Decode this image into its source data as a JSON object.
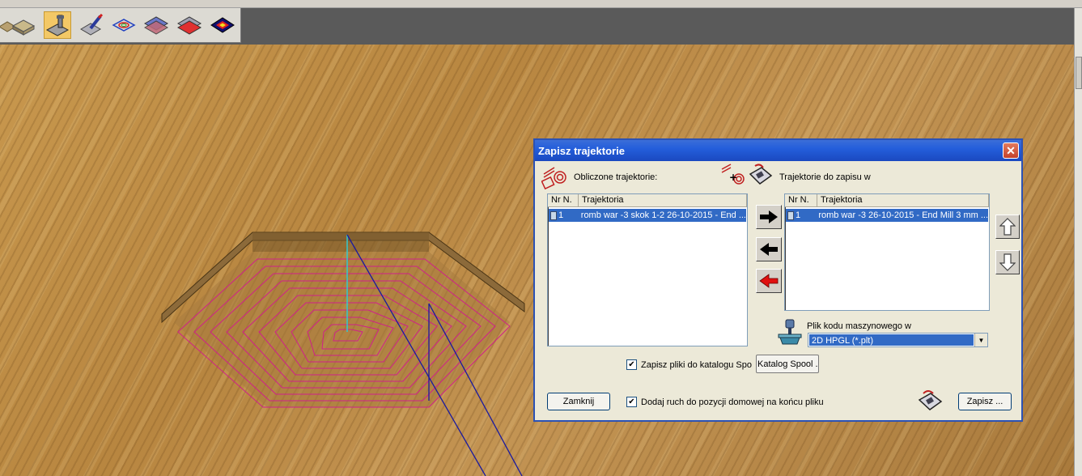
{
  "toolbar": {
    "buttons": [
      {
        "icon": "material-block-icon"
      },
      {
        "icon": "mill-tool-icon",
        "active": true
      },
      {
        "icon": "brush-icon"
      },
      {
        "icon": "layers-outline-icon"
      },
      {
        "icon": "layer-blue-icon"
      },
      {
        "icon": "layer-red-icon"
      },
      {
        "icon": "heatmap-diamond-icon"
      }
    ]
  },
  "dialog": {
    "title": "Zapisz trajektorie",
    "computed_label": "Obliczone trajektorie:",
    "to_save_label": "Trajektorie do zapisu w",
    "left_list": {
      "columns": [
        "Nr N.",
        "Trajektoria"
      ],
      "rows": [
        {
          "nr": "1",
          "name": "romb war -3 skok 1-2  26-10-2015 - End ..."
        }
      ]
    },
    "right_list": {
      "columns": [
        "Nr N.",
        "Trajektoria"
      ],
      "rows": [
        {
          "nr": "1",
          "name": "romb war -3   26-10-2015 - End Mill 3 mm ..."
        }
      ]
    },
    "machine_code_label": "Plik kodu maszynowego w",
    "machine_code_value": "2D HPGL (*.plt)",
    "spool_checkbox_label": "Zapisz pliki do katalogu Spo",
    "spool_button": "Katalog Spool ..",
    "home_checkbox_label": "Dodaj ruch do pozycji domowej na końcu pliku",
    "close_button": "Zamknij",
    "save_button": "Zapisz ..."
  }
}
